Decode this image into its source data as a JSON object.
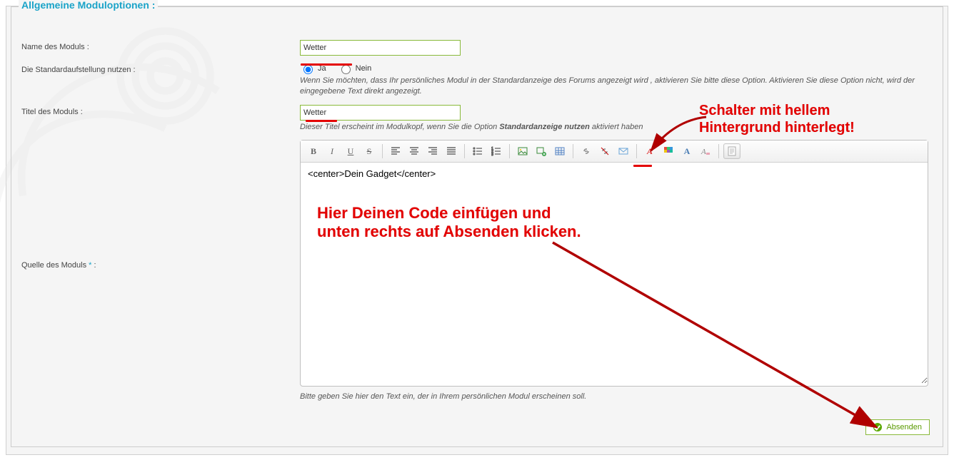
{
  "section_title": "Allgemeine Moduloptionen :",
  "labels": {
    "module_name": "Name des Moduls :",
    "use_default_layout": "Die Standardaufstellung nutzen :",
    "module_title": "Titel des Moduls :",
    "module_source": "Quelle des Moduls",
    "required_star": "*",
    "colon": ":"
  },
  "fields": {
    "module_name_value": "Wetter",
    "radio_yes": "Ja",
    "radio_no": "Nein",
    "radio_selected": "yes",
    "default_layout_hint": "Wenn Sie möchten, dass Ihr persönliches Modul in der Standardanzeige des Forums angezeigt wird , aktivieren Sie bitte diese Option. Aktivieren Sie diese Option nicht, wird der eingegebene Text direkt angezeigt.",
    "module_title_value": "Wetter",
    "module_title_hint_pre": "Dieser Titel erscheint im Modulkopf, wenn Sie die Option ",
    "module_title_hint_bold": "Standardanzeige nutzen",
    "module_title_hint_post": " aktiviert haben",
    "editor_content": "<center>Dein Gadget</center>",
    "source_hint": "Bitte geben Sie hier den Text ein, der in Ihrem persönlichen Modul erscheinen soll."
  },
  "toolbar": {
    "bold": "B",
    "italic": "I",
    "underline": "U",
    "strike": "S"
  },
  "submit_label": "Absenden",
  "annotations": {
    "toggle_hint_line1": "Schalter mit hellem",
    "toggle_hint_line2": "Hintergrund hinterlegt!",
    "code_hint_line1": "Hier Deinen Code einfügen und",
    "code_hint_line2": "unten rechts auf Absenden klicken."
  }
}
